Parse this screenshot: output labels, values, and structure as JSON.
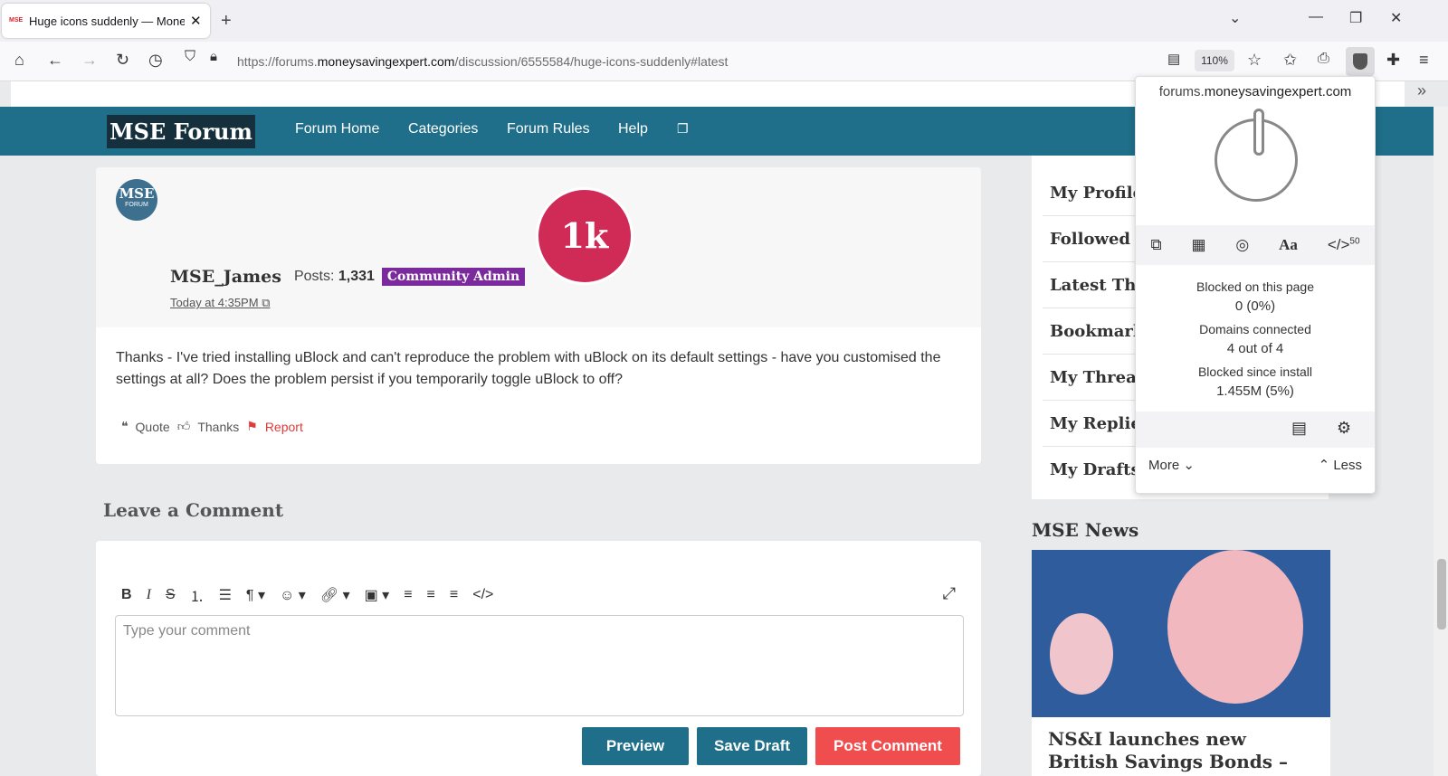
{
  "browser": {
    "tab_title": "Huge icons suddenly — MoneyS",
    "tab_favicon": "MSE",
    "url_prefix": "https://forums.",
    "url_domain": "moneysavingexpert.com",
    "url_path": "/discussion/6555584/huge-icons-suddenly#latest",
    "zoom": "110%"
  },
  "site": {
    "logo": "MSE Forum",
    "nav": [
      "Forum Home",
      "Categories",
      "Forum Rules",
      "Help"
    ]
  },
  "post": {
    "avatar_top": "MSE",
    "avatar_bottom": "FORUM",
    "badge": "1k",
    "author": "MSE_James",
    "posts_label": "Posts:",
    "posts_count": "1,331",
    "role": "Community Admin",
    "timestamp": "Today at 4:35PM",
    "body": "Thanks - I've tried installing uBlock and can't reproduce the problem with uBlock on its default settings - have you customised the settings at all? Does the problem persist if you temporarily toggle uBlock to off?",
    "actions": {
      "quote": "Quote",
      "thanks": "Thanks",
      "report": "Report"
    }
  },
  "comment": {
    "title": "Leave a Comment",
    "placeholder": "Type your comment",
    "preview": "Preview",
    "save_draft": "Save Draft",
    "post": "Post Comment"
  },
  "sidebar": {
    "items": [
      "My Profile",
      "Followed C",
      "Latest Thr",
      "Bookmark",
      "My Thread",
      "My Replies",
      "My Drafts"
    ],
    "news_title": "MSE News",
    "news_headline": "NS&I launches new British Savings Bonds – but how do"
  },
  "ublock": {
    "host_prefix": "forums.",
    "host_domain": "moneysavingexpert.com",
    "script_count": "50",
    "blocked_page_label": "Blocked on this page",
    "blocked_page_value": "0 (0%)",
    "domains_label": "Domains connected",
    "domains_value": "4 out of 4",
    "blocked_install_label": "Blocked since install",
    "blocked_install_value": "1.455M (5%)",
    "more": "More",
    "less": "Less"
  }
}
